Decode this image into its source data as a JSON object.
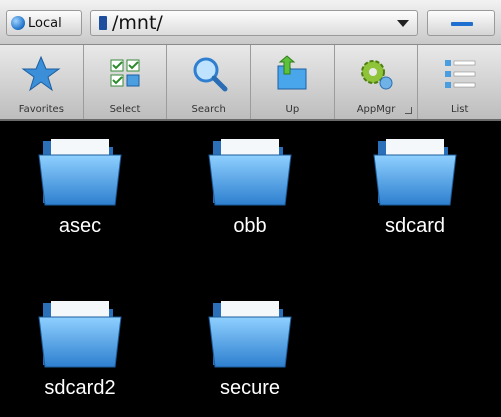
{
  "location": {
    "local_label": "Local",
    "path": "/mnt/"
  },
  "toolbar": {
    "items": [
      {
        "label": "Favorites",
        "icon": "star-icon"
      },
      {
        "label": "Select",
        "icon": "select-grid-icon"
      },
      {
        "label": "Search",
        "icon": "magnifier-icon"
      },
      {
        "label": "Up",
        "icon": "folder-up-icon"
      },
      {
        "label": "AppMgr",
        "icon": "gear-icon"
      },
      {
        "label": "List",
        "icon": "list-icon"
      }
    ]
  },
  "folders": [
    {
      "name": "asec"
    },
    {
      "name": "obb"
    },
    {
      "name": "sdcard"
    },
    {
      "name": "sdcard2"
    },
    {
      "name": "secure"
    }
  ],
  "colors": {
    "accent": "#1f6fd0",
    "folder": "#4aa6ea"
  }
}
